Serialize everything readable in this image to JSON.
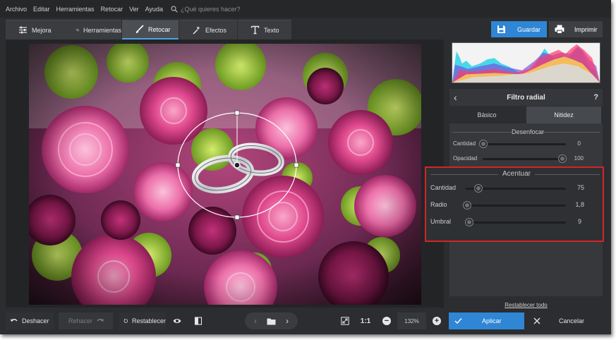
{
  "menu": {
    "items": [
      "Archivo",
      "Editar",
      "Herramientas",
      "Retocar",
      "Ver",
      "Ayuda"
    ],
    "search_placeholder": "¿Qué quieres hacer?"
  },
  "tabs": [
    {
      "label": "Mejora",
      "icon": "sliders-icon"
    },
    {
      "label": "Herramientas",
      "icon": "crop-icon"
    },
    {
      "label": "Retocar",
      "icon": "brush-icon",
      "active": true
    },
    {
      "label": "Efectos",
      "icon": "magic-wand-icon"
    },
    {
      "label": "Texto",
      "icon": "text-icon"
    }
  ],
  "toolbar": {
    "save_label": "Guardar",
    "print_label": "Imprimir"
  },
  "panel": {
    "title": "Filtro radial",
    "back_icon": "‹",
    "help_icon": "?",
    "subtabs": [
      "Básico",
      "Nitidez"
    ],
    "active_subtab": "Nitidez",
    "blur_section": {
      "title": "Desenfocar",
      "sliders": [
        {
          "label": "Cantidad",
          "value": "0",
          "fraction": 0.0
        },
        {
          "label": "Opacidad",
          "value": "100",
          "fraction": 1.0
        }
      ]
    },
    "sharpen_section": {
      "title": "Acentuar",
      "sliders": [
        {
          "label": "Cantidad",
          "value": "75",
          "fraction": 0.09
        },
        {
          "label": "Radio",
          "value": "1,8",
          "fraction": 0.02
        },
        {
          "label": "Umbral",
          "value": "9",
          "fraction": 0.035
        }
      ]
    },
    "reset_all": "Restablecer todo"
  },
  "bottom": {
    "undo": "Deshacer",
    "redo": "Rehacer",
    "reset": "Restablecer",
    "one_to_one": "1:1",
    "zoom": "132%",
    "apply": "Aplicar",
    "cancel": "Cancelar"
  },
  "colors": {
    "accent": "#2f86d4",
    "highlight_border": "#d42427"
  }
}
